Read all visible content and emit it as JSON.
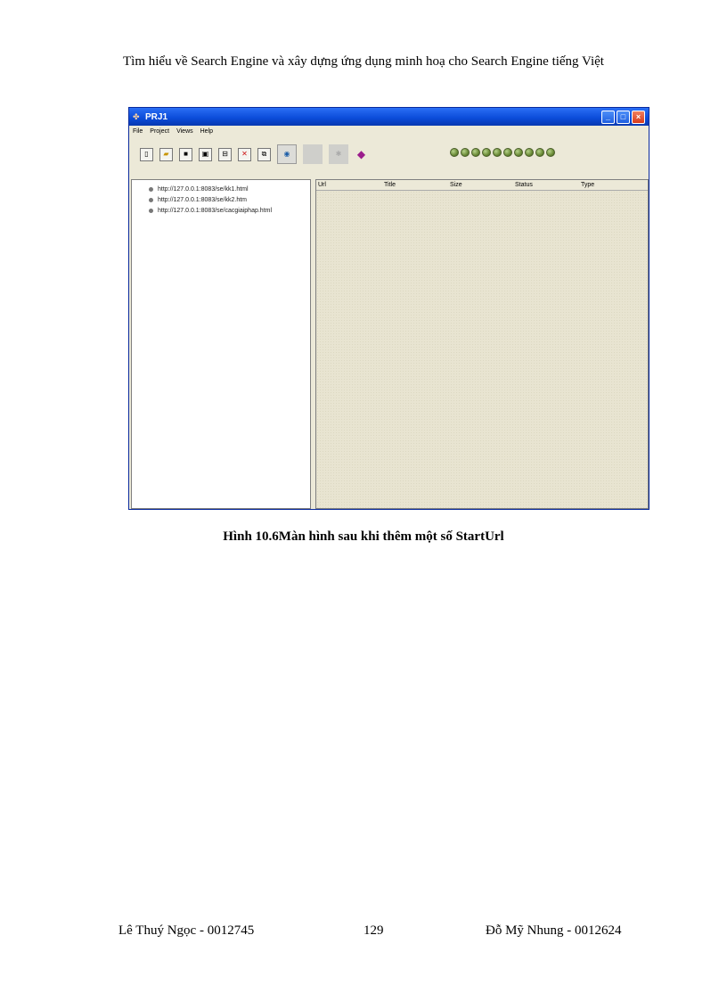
{
  "page": {
    "header": "Tìm hiểu về Search Engine và xây dựng ứng dụng minh hoạ cho Search Engine tiếng Việt",
    "caption": "Hình 10.6Màn hình sau khi thêm một số StartUrl",
    "footer_left": "Lê Thuý Ngọc - 0012745",
    "page_number": "129",
    "footer_right": "Đỗ Mỹ Nhung - 0012624"
  },
  "window": {
    "title": "PRJ1",
    "menu": [
      "File",
      "Project",
      "Views",
      "Help"
    ],
    "tree_items": [
      "http://127.0.0.1:8083/se/kk1.html",
      "http://127.0.0.1:8083/se/kk2.htm",
      "http://127.0.0.1:8083/se/cacgiaiphap.html"
    ],
    "columns": [
      "Url",
      "Title",
      "Size",
      "Status",
      "Type"
    ],
    "status_lights": 10,
    "colors": {
      "titlebar": "#0a4ad8",
      "panel": "#ece9d8",
      "light": "#6a8a36"
    }
  }
}
